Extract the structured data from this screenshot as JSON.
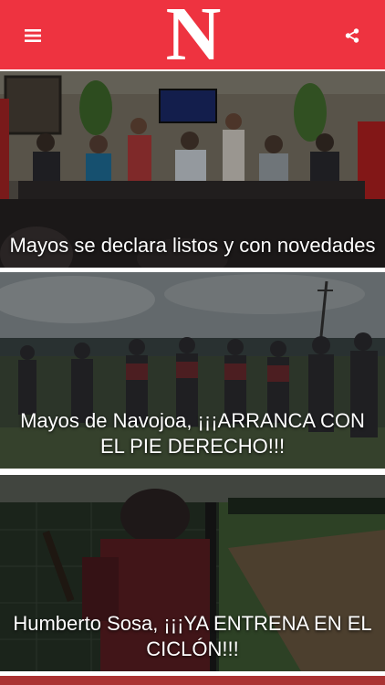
{
  "header": {
    "logo_text": "N",
    "menu_icon": "hamburger-menu-icon",
    "share_icon": "share-icon",
    "brand_color": "#ee3340"
  },
  "articles": [
    {
      "headline": "Mayos se declara listos y con novedades"
    },
    {
      "headline": "Mayos de Navojoa, ¡¡¡ARRANCA CON EL PIE DERECHO!!!"
    },
    {
      "headline": "Humberto Sosa, ¡¡¡YA ENTRENA EN EL CICLÓN!!!"
    }
  ]
}
